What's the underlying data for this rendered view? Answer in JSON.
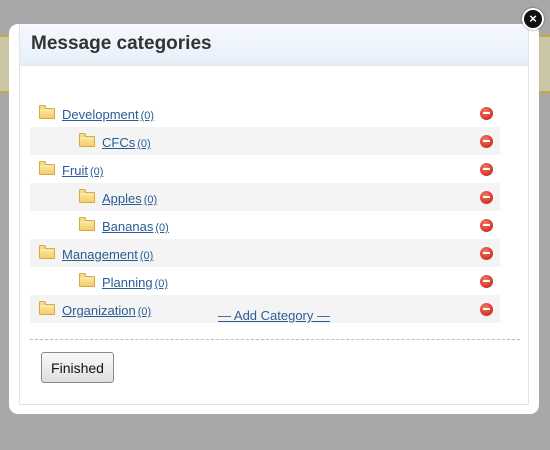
{
  "dialog": {
    "title": "Message categories",
    "close_glyph": "×",
    "add_category_label": "— Add Category —",
    "finished_label": "Finished"
  },
  "categories": [
    {
      "name": "Development",
      "count": "(0)",
      "level": 0
    },
    {
      "name": "CFCs",
      "count": "(0)",
      "level": 1
    },
    {
      "name": "Fruit",
      "count": "(0)",
      "level": 0
    },
    {
      "name": "Apples",
      "count": "(0)",
      "level": 1
    },
    {
      "name": "Bananas",
      "count": "(0)",
      "level": 1
    },
    {
      "name": "Management",
      "count": "(0)",
      "level": 0
    },
    {
      "name": "Planning",
      "count": "(0)",
      "level": 1
    },
    {
      "name": "Organization",
      "count": "(0)",
      "level": 0
    }
  ],
  "icons": {
    "folder": "folder-icon",
    "delete": "delete-icon",
    "close": "close-icon"
  },
  "colors": {
    "link": "#2a5d96",
    "delete": "#d9392b",
    "header_gradient_top": "#f6f9fd",
    "header_gradient_bottom": "#e6eff9"
  }
}
